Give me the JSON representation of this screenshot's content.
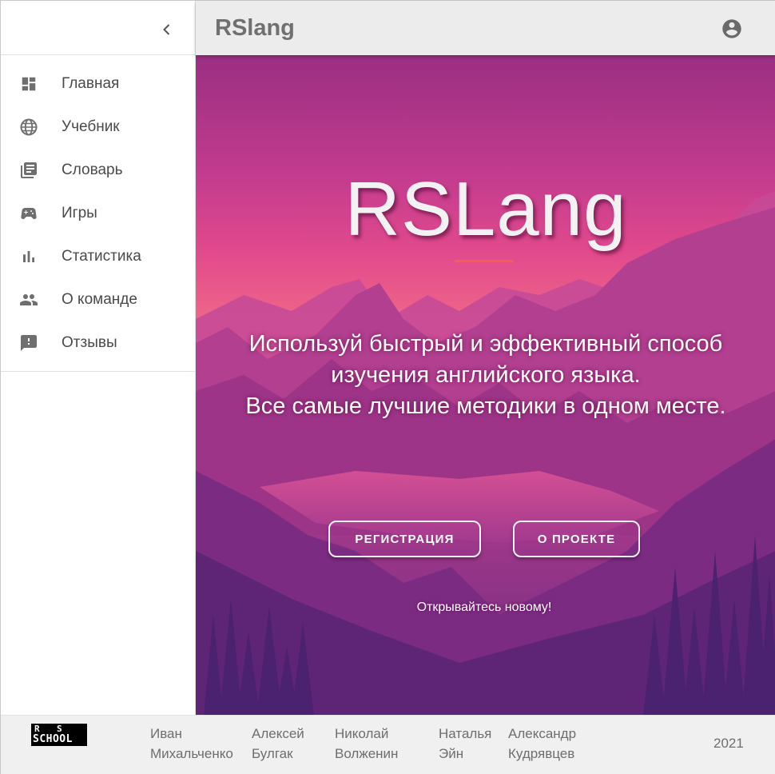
{
  "header": {
    "title": "RSlang"
  },
  "sidebar": {
    "items": [
      {
        "label": "Главная",
        "icon": "dashboard-icon"
      },
      {
        "label": "Учебник",
        "icon": "globe-icon"
      },
      {
        "label": "Словарь",
        "icon": "library-books-icon"
      },
      {
        "label": "Игры",
        "icon": "gamepad-icon"
      },
      {
        "label": "Статистика",
        "icon": "bar-chart-icon"
      },
      {
        "label": "О команде",
        "icon": "people-icon"
      },
      {
        "label": "Отзывы",
        "icon": "feedback-icon"
      }
    ]
  },
  "hero": {
    "title": "RSLang",
    "text_lines": [
      "Используй быстрый и эффективный способ",
      "изучения английского языка.",
      "Все самые лучшие методики в одном месте."
    ],
    "register_label": "РЕГИСТРАЦИЯ",
    "about_label": "О ПРОЕКТЕ",
    "tagline": "Открывайтесь новому!"
  },
  "footer": {
    "logo": {
      "r": "R",
      "s": "S",
      "school": "SCHOOL"
    },
    "authors": [
      {
        "first": "Иван",
        "last": "Михальченко"
      },
      {
        "first": "Алексей",
        "last": "Булгак"
      },
      {
        "first": "Николай",
        "last": "Волженин"
      },
      {
        "first": "Наталья",
        "last": "Эйн"
      },
      {
        "first": "Александр",
        "last": "Кудрявцев"
      }
    ],
    "year": "2021"
  },
  "colors": {
    "accent_line": "#f0604a",
    "topbar_bg": "#ececec",
    "icon_gray": "#6f6f6f"
  }
}
